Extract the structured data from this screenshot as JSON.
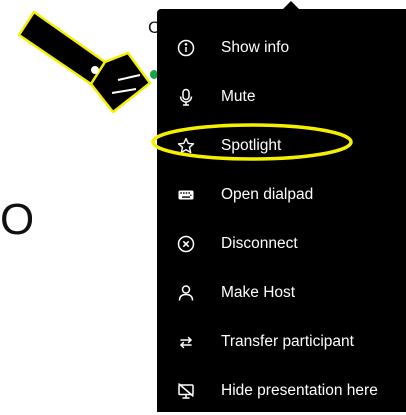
{
  "background": {
    "top_fragment": "C",
    "big_fragment": "O"
  },
  "menu": {
    "items": [
      {
        "label": "Show info",
        "icon": "info-icon"
      },
      {
        "label": "Mute",
        "icon": "microphone-icon"
      },
      {
        "label": "Spotlight",
        "icon": "star-icon"
      },
      {
        "label": "Open dialpad",
        "icon": "keyboard-icon"
      },
      {
        "label": "Disconnect",
        "icon": "circle-x-icon"
      },
      {
        "label": "Make Host",
        "icon": "person-icon"
      },
      {
        "label": "Transfer participant",
        "icon": "transfer-arrows-icon"
      },
      {
        "label": "Hide presentation here",
        "icon": "monitor-off-icon"
      }
    ]
  },
  "colors": {
    "menu_background": "#000000",
    "menu_text": "#ffffff",
    "highlight": "#f5f000",
    "status_dot": "#16a34a"
  }
}
